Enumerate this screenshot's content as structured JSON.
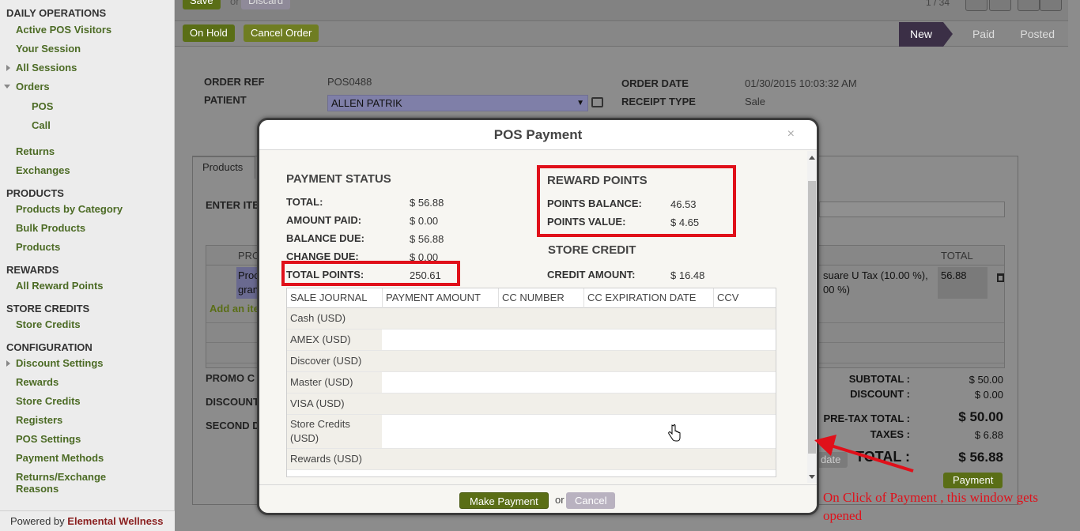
{
  "sidebar": {
    "sections": {
      "daily_operations": "DAILY OPERATIONS",
      "products": "PRODUCTS",
      "rewards": "REWARDS",
      "store_credits": "STORE CREDITS",
      "configuration": "CONFIGURATION"
    },
    "items": {
      "active_pos_visitors": "Active POS Visitors",
      "your_session": "Your Session",
      "all_sessions": "All Sessions",
      "orders": "Orders",
      "pos": "POS",
      "call": "Call",
      "returns": "Returns",
      "exchanges": "Exchanges",
      "products_by_category": "Products by Category",
      "bulk_products": "Bulk Products",
      "products": "Products",
      "all_reward_points": "All Reward Points",
      "store_credits": "Store Credits",
      "discount_settings": "Discount Settings",
      "rewards": "Rewards",
      "store_credits_cfg": "Store Credits",
      "registers": "Registers",
      "pos_settings": "POS Settings",
      "payment_methods": "Payment Methods",
      "returns_exchange_reasons": "Returns/Exchange Reasons"
    },
    "powered_by": "Powered by",
    "powered_brand": "Elemental Wellness"
  },
  "topbar": {
    "save_label": "Save",
    "or": "or",
    "discard_label": "Discard",
    "pager": "1 / 34"
  },
  "actionbar": {
    "on_hold": "On Hold",
    "cancel_order": "Cancel Order",
    "status_new": "New",
    "status_paid": "Paid",
    "status_posted": "Posted"
  },
  "form": {
    "order_ref_label": "ORDER REF",
    "order_ref": "POS0488",
    "patient_label": "PATIENT",
    "patient": "ALLEN PATRIK",
    "order_date_label": "ORDER DATE",
    "order_date": "01/30/2015 10:03:32 AM",
    "receipt_type_label": "RECEIPT TYPE",
    "receipt_type": "Sale",
    "tab_products": "Products",
    "enter_item": "ENTER ITE",
    "col_pro": "PRO",
    "col_total": "TOTAL",
    "row_prod_1": "Proc",
    "row_prod_2": "gran",
    "row_tax_1": "suare U Tax (10.00 %),",
    "row_tax_2": "00 %)",
    "row_total": "56.88",
    "add_item": "Add an ite",
    "promo": "PROMO C",
    "discount": "DISCOUNT",
    "second": "SECOND D",
    "update_btn": "date"
  },
  "totals": {
    "subtotal_label": "SUBTOTAL :",
    "subtotal": "$ 50.00",
    "discount_label": "DISCOUNT :",
    "discount": "$ 0.00",
    "pretax_label": "PRE-TAX TOTAL :",
    "pretax": "$ 50.00",
    "taxes_label": "TAXES :",
    "taxes": "$ 6.88",
    "total_label": "TOTAL :",
    "total": "$ 56.88",
    "payment_btn": "Payment"
  },
  "modal": {
    "title": "POS Payment",
    "close": "×",
    "payment_status": {
      "heading": "PAYMENT STATUS",
      "total_label": "TOTAL:",
      "total": "$ 56.88",
      "amount_paid_label": "AMOUNT PAID:",
      "amount_paid": "$ 0.00",
      "balance_due_label": "BALANCE DUE:",
      "balance_due": "$ 56.88",
      "change_due_label": "CHANGE DUE:",
      "change_due": "$ 0.00",
      "total_points_label": "TOTAL POINTS:",
      "total_points": "250.61"
    },
    "reward_points": {
      "heading": "REWARD POINTS",
      "balance_label": "POINTS BALANCE:",
      "balance": "46.53",
      "value_label": "POINTS VALUE:",
      "value": "$ 4.65"
    },
    "store_credit": {
      "heading": "STORE CREDIT",
      "amount_label": "CREDIT AMOUNT:",
      "amount": "$ 16.48"
    },
    "table": {
      "headers": [
        "SALE JOURNAL",
        "PAYMENT AMOUNT",
        "CC NUMBER",
        "CC EXPIRATION DATE",
        "CCV"
      ],
      "rows": [
        "Cash (USD)",
        "AMEX (USD)",
        "Discover (USD)",
        "Master (USD)",
        "VISA (USD)",
        "Store Credits (USD)",
        "Rewards (USD)"
      ]
    },
    "make_payment": "Make Payment",
    "or": "or",
    "cancel": "Cancel"
  },
  "annotation": {
    "text": "On Click of Payment , this window gets opened"
  },
  "colors": {
    "highlight": "#e0101a",
    "accent": "#5a6e16",
    "link": "#4c6b25"
  }
}
